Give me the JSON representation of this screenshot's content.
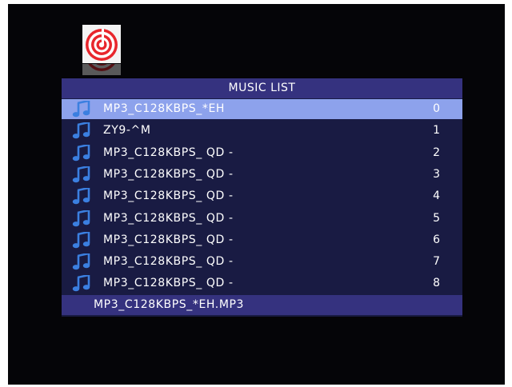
{
  "panel": {
    "title": "MUSIC LIST"
  },
  "icons": {
    "app": "spiral-logo-icon",
    "track": "music-note-icon"
  },
  "colors": {
    "screen": "#050508",
    "panel": "#191b43",
    "header": "#35327f",
    "selected_row": "#8da2ec",
    "note_icon": "#3b7fe0",
    "text": "#ffffff"
  },
  "tracks": [
    {
      "title": "MP3_C128KBPS_*EH",
      "index": "0",
      "selected": true
    },
    {
      "title": "ZY9-^M",
      "index": "1"
    },
    {
      "title": "MP3_C128KBPS_ QD -",
      "index": "2"
    },
    {
      "title": "MP3_C128KBPS_ QD -",
      "index": "3"
    },
    {
      "title": "MP3_C128KBPS_ QD -",
      "index": "4"
    },
    {
      "title": "MP3_C128KBPS_ QD -",
      "index": "5"
    },
    {
      "title": "MP3_C128KBPS_ QD -",
      "index": "6"
    },
    {
      "title": "MP3_C128KBPS_ QD -",
      "index": "7"
    },
    {
      "title": "MP3_C128KBPS_ QD -",
      "index": "8"
    }
  ],
  "footer": {
    "filename": "MP3_C128KBPS_*EH.MP3"
  }
}
